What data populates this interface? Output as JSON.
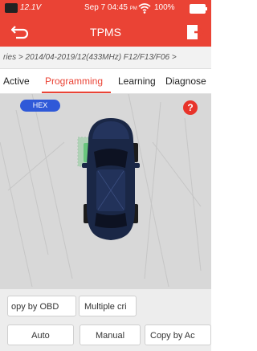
{
  "status_bar": {
    "voltage": "12.1V",
    "datetime": "Sep 7 04:45 ",
    "ampm": "PM",
    "battery_percent": "100%",
    "icons": [
      "obd-battery-icon",
      "wifi-icon",
      "battery-icon"
    ]
  },
  "title_bar": {
    "title": "TPMS",
    "back_icon": "back-arrow-icon",
    "exit_icon": "exit-icon"
  },
  "breadcrumb": {
    "text": "ries > 2014/04-2019/12(433MHz) F12/F13/F06 >"
  },
  "tabs": [
    {
      "label": "Active",
      "active": false
    },
    {
      "label": "Programming",
      "active": true
    },
    {
      "label": "Learning",
      "active": false
    },
    {
      "label": "Diagnose",
      "active": false
    }
  ],
  "work_area": {
    "hex_label": "HEX",
    "help_label": "?"
  },
  "buttons_row1": [
    {
      "label": "opy by OBD"
    },
    {
      "label": "Multiple cri"
    }
  ],
  "buttons_row2": [
    {
      "label": "Auto"
    },
    {
      "label": "Manual"
    },
    {
      "label": "Copy by Ac"
    }
  ],
  "colors": {
    "accent": "#ea4335",
    "hex_badge": "#2f59d8",
    "selected_wheel": "#59c271"
  }
}
